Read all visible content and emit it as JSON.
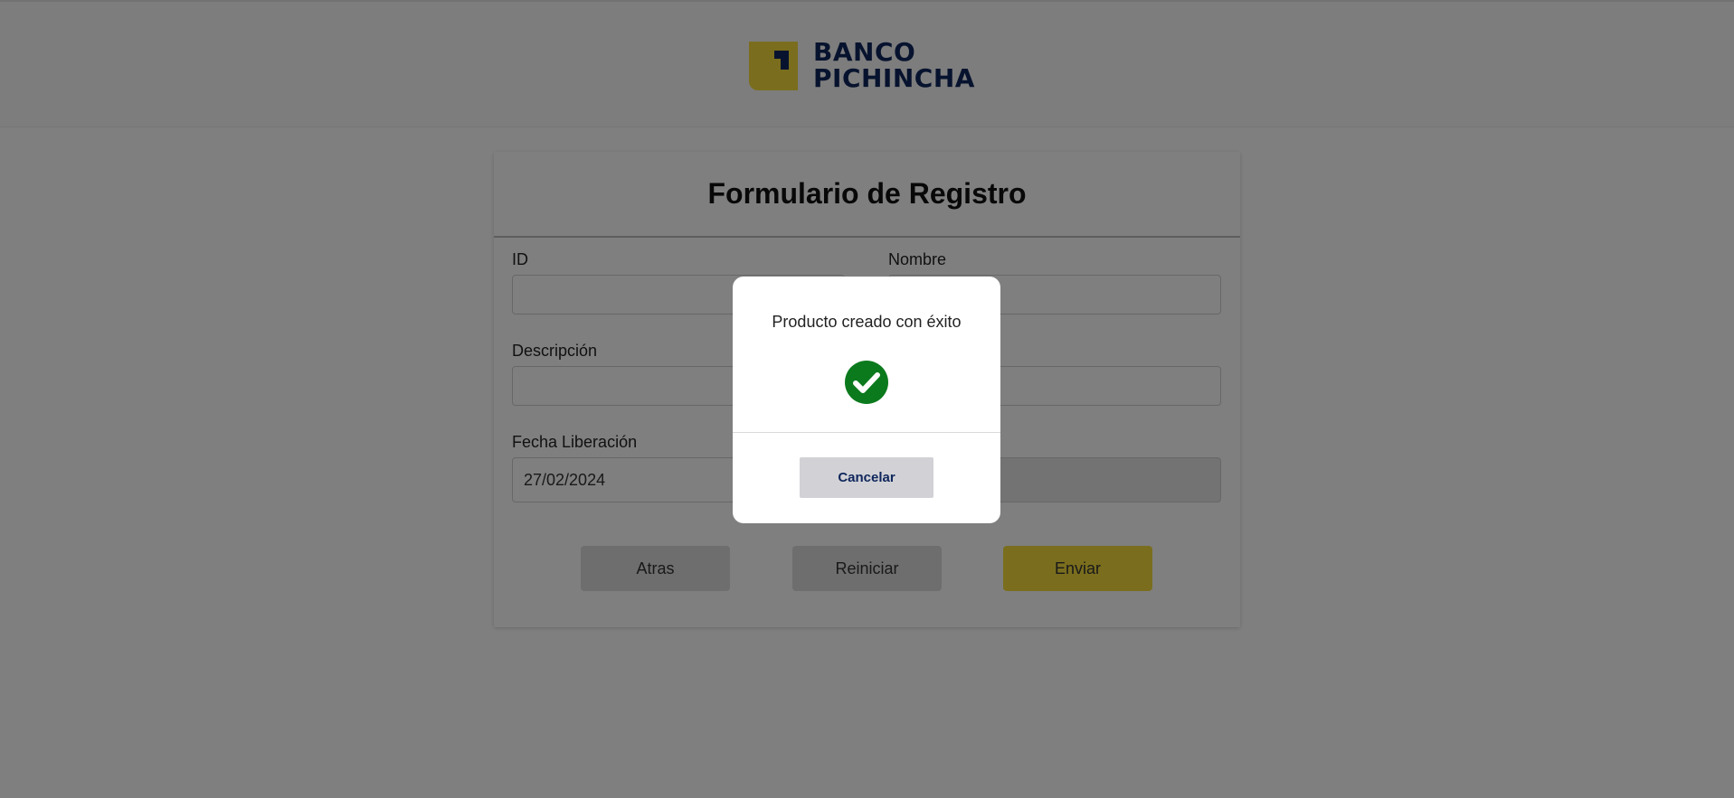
{
  "brand": {
    "line1": "BANCO",
    "line2": "PICHINCHA",
    "colors": {
      "navy": "#0f265c",
      "yellow": "#f5dc3d"
    }
  },
  "form": {
    "title": "Formulario de Registro",
    "fields": {
      "id": {
        "label": "ID",
        "value": ""
      },
      "nombre": {
        "label": "Nombre",
        "value": ""
      },
      "descripcion": {
        "label": "Descripción",
        "value": ""
      },
      "logo": {
        "label": "",
        "value": ""
      },
      "fecha_liberacion": {
        "label": "Fecha Liberación",
        "value": "27/02/2024"
      },
      "fecha_revision": {
        "label": "",
        "value": ""
      }
    },
    "buttons": {
      "atras": "Atras",
      "reiniciar": "Reiniciar",
      "enviar": "Enviar"
    }
  },
  "modal": {
    "message": "Producto creado con éxito",
    "icon": "check-circle-icon",
    "icon_color": "#0b7a1d",
    "cancel_label": "Cancelar"
  }
}
